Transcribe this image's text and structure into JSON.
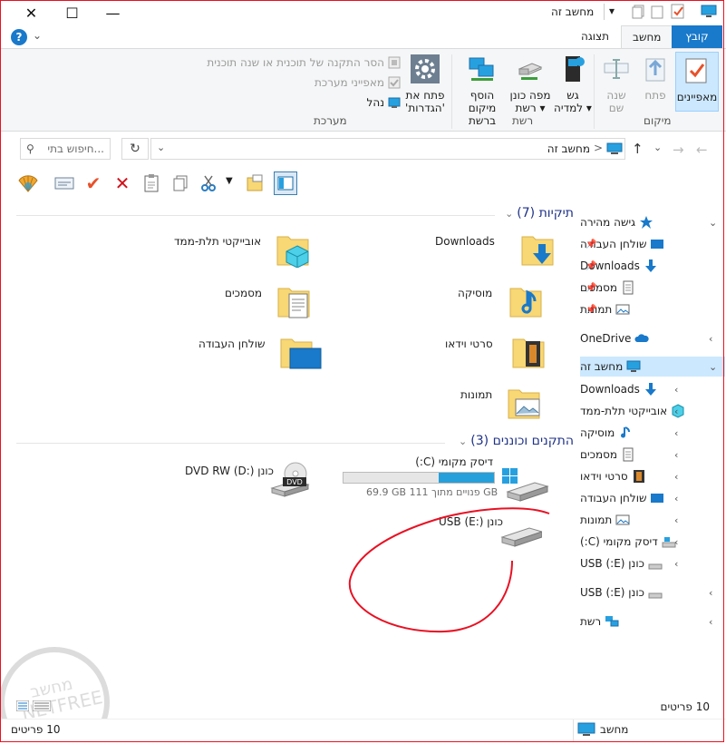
{
  "window": {
    "title": "מחשב זה",
    "minimize": "—",
    "maximize": "☐",
    "close": "✕"
  },
  "tabs": [
    {
      "label": "קובץ"
    },
    {
      "label": "מחשב"
    },
    {
      "label": "תצוגה"
    }
  ],
  "ribbon": {
    "location_group": "מיקום",
    "network_group": "רשת",
    "system_group": "מערכת",
    "properties": "מאפיינים",
    "open": "פתח",
    "rename_1": "שנה",
    "rename_2": "שם",
    "access_media_1": "גש",
    "access_media_2": "למדיה ▾",
    "map_drive_1": "מפה כונן",
    "map_drive_2": "רשת ▾",
    "add_location_1": "הוסף מיקום",
    "add_location_2": "ברשת",
    "open_settings_1": "פתח את",
    "open_settings_2": "'הגדרות'",
    "uninstall": "הסר התקנה של תוכנית או שנה תוכנית",
    "system_props": "מאפייני מערכת",
    "manage": "נהל"
  },
  "address": {
    "path": "מחשב זה",
    "separator": ">",
    "search_placeholder": "חיפוש בתי..."
  },
  "nav": {
    "quick_access": "גישה מהירה",
    "qa_items": [
      "שולחן העבודה",
      "Downloads",
      "מסמכים",
      "תמונות"
    ],
    "onedrive": "OneDrive",
    "this_pc": "מחשב זה",
    "pc_items": [
      "Downloads",
      "אובייקטי תלת-ממד",
      "מוסיקה",
      "מסמכים",
      "סרטי וידאו",
      "שולחן העבודה",
      "תמונות",
      "דיסק מקומי (C:)",
      "כונן (E:) USB"
    ],
    "usb": "כונן (E:) USB",
    "network": "רשת"
  },
  "folders_header": "תיקיות (7)",
  "folders": [
    {
      "name": "Downloads",
      "icon": "download-arrow"
    },
    {
      "name": "אובייקטי תלת-ממד",
      "icon": "3d-cube"
    },
    {
      "name": "מוסיקה",
      "icon": "music-note"
    },
    {
      "name": "מסמכים",
      "icon": "document"
    },
    {
      "name": "סרטי וידאו",
      "icon": "film"
    },
    {
      "name": "שולחן העבודה",
      "icon": "desktop"
    },
    {
      "name": "תמונות",
      "icon": "picture"
    }
  ],
  "drives_header": "התקנים וכוננים (3)",
  "drives": {
    "c_name": "דיסק מקומי (C:)",
    "c_free": "69.9 GB פנויים מתוך 111 GB",
    "c_used_fraction": 0.37,
    "dvd_name": "כונן DVD RW (D:)",
    "dvd_label": "DVD",
    "usb_name": "כונן USB (E:)"
  },
  "status": {
    "count": "10 פריטים",
    "right_count": "10 פריטים",
    "location": "מחשב"
  },
  "colors": {
    "accent": "#1979ca",
    "annotation": "#e81123",
    "folder": "#f8d775"
  }
}
